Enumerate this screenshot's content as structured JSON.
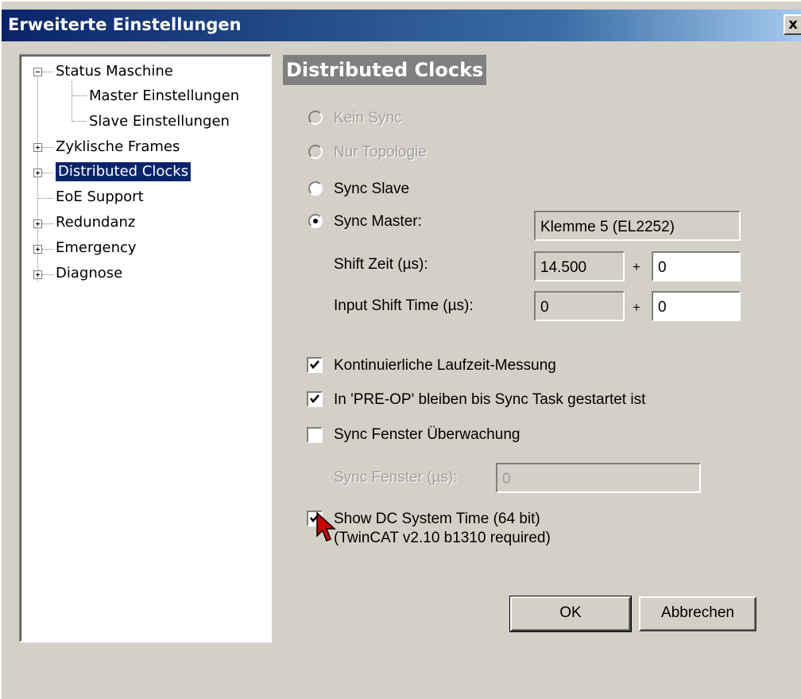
{
  "window": {
    "title": "Erweiterte Einstellungen",
    "close_glyph": "x"
  },
  "tree": {
    "items": [
      {
        "label": "Status Maschine",
        "expander": "minus"
      },
      {
        "label": "Master Einstellungen",
        "expander": "none"
      },
      {
        "label": "Slave Einstellungen",
        "expander": "none"
      },
      {
        "label": "Zyklische Frames",
        "expander": "plus"
      },
      {
        "label": "Distributed Clocks",
        "expander": "plus",
        "selected": true
      },
      {
        "label": "EoE Support",
        "expander": "none"
      },
      {
        "label": "Redundanz",
        "expander": "plus"
      },
      {
        "label": "Emergency",
        "expander": "plus"
      },
      {
        "label": "Diagnose",
        "expander": "plus"
      }
    ]
  },
  "panel": {
    "title": "Distributed Clocks",
    "sync_options": [
      {
        "label": "Kein Sync",
        "enabled": false,
        "selected": false
      },
      {
        "label": "Nur Topologie",
        "enabled": false,
        "selected": false
      },
      {
        "label": "Sync Slave",
        "enabled": true,
        "selected": false
      },
      {
        "label": "Sync Master:",
        "enabled": true,
        "selected": true
      }
    ],
    "sync_master_value": "Klemme 5 (EL2252)",
    "shift_time": {
      "label": "Shift Zeit (µs):",
      "value": "14.500",
      "plus": "+",
      "offset": "0"
    },
    "input_shift_time": {
      "label": "Input Shift Time (µs):",
      "value": "0",
      "plus": "+",
      "offset": "0"
    },
    "checkboxes": [
      {
        "label": "Kontinuierliche Laufzeit-Messung",
        "checked": true
      },
      {
        "label": "In 'PRE-OP' bleiben bis Sync Task gestartet ist",
        "checked": true
      },
      {
        "label": "Sync Fenster Überwachung",
        "checked": false
      }
    ],
    "sync_window": {
      "label": "Sync Fenster (µs):",
      "value": "0",
      "enabled": false
    },
    "show_dc": {
      "label": "Show DC System Time (64 bit)",
      "note": "(TwinCAT v2.10 b1310 required)",
      "checked": true
    }
  },
  "buttons": {
    "ok": "OK",
    "cancel": "Abbrechen"
  },
  "colors": {
    "title_bar": "#0a246a",
    "selection": "#0a246a",
    "dialog_bg": "#d4d0c8",
    "cursor": "#cc0000"
  }
}
